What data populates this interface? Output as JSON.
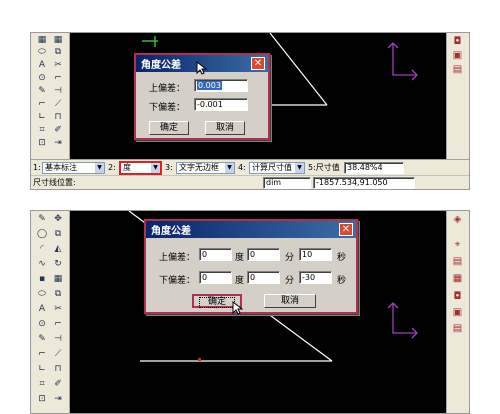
{
  "top": {
    "dialog": {
      "title": "角度公差",
      "upper_label": "上偏差：",
      "upper_value": "0.003",
      "lower_label": "下偏差：",
      "lower_value": "-0.001",
      "ok_label": "确定",
      "cancel_label": "取消"
    },
    "statusbar": {
      "item1_num": "1:",
      "item1_value": "基本标注",
      "item2_num": "2:",
      "item2_value": "度",
      "item3_num": "3:",
      "item3_value": "文字无边框",
      "item4_num": "4:",
      "item4_value": "计算尺寸值",
      "item5_num": "5:尺寸值",
      "item5_value": "38.48%4",
      "prompt": "尺寸线位置:",
      "cmd": "dim",
      "coords": "-1857.534,91.050"
    }
  },
  "bottom": {
    "dialog": {
      "title": "角度公差",
      "upper_label": "上偏差：",
      "upper_deg": "0",
      "deg_unit": "度",
      "upper_min": "0",
      "min_unit": "分",
      "upper_sec": "10",
      "sec_unit": "秒",
      "lower_label": "下偏差：",
      "lower_deg": "0",
      "lower_min": "0",
      "lower_sec": "-30",
      "ok_label": "确定",
      "cancel_label": "取消"
    }
  },
  "colors": {
    "canvas": "#000000",
    "title_bar": "#0a246a",
    "dialog_frame": "#b03050",
    "highlight": "#e02020",
    "arrow": "#a040c0"
  }
}
